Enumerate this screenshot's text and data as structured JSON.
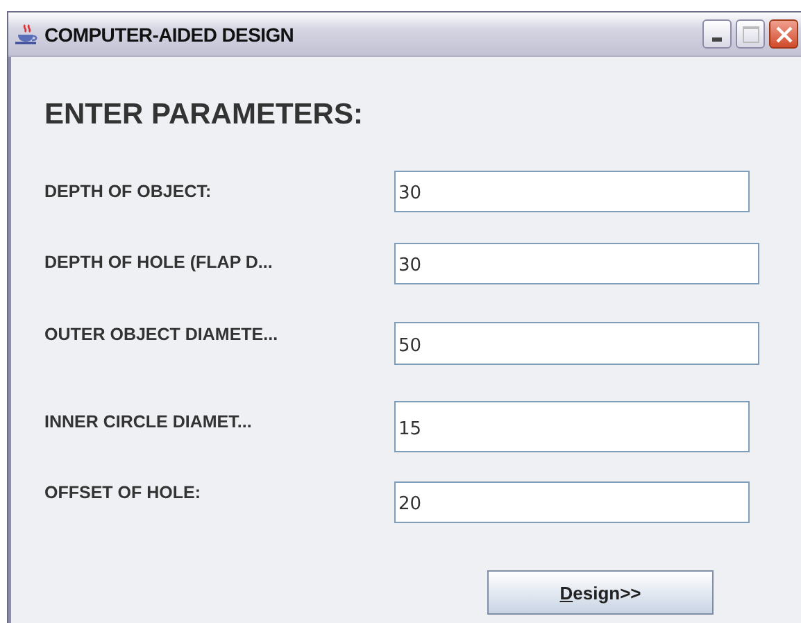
{
  "window": {
    "title": "COMPUTER-AIDED DESIGN"
  },
  "heading": "ENTER PARAMETERS:",
  "fields": [
    {
      "label": "DEPTH OF OBJECT:",
      "value": "30"
    },
    {
      "label": "DEPTH OF HOLE (FLAP D...",
      "value": "30"
    },
    {
      "label": "OUTER OBJECT DIAMETE...",
      "value": "50"
    },
    {
      "label": "INNER CIRCLE DIAMET...",
      "value": "15"
    },
    {
      "label": "OFFSET OF HOLE:",
      "value": "20"
    }
  ],
  "button": {
    "label": "Design>>"
  }
}
